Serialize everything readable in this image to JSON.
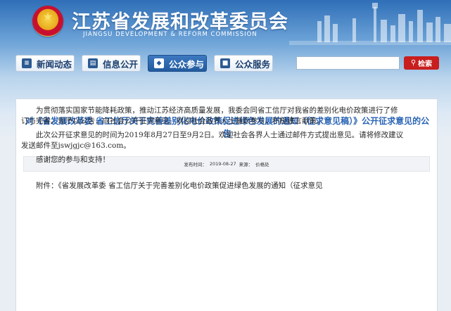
{
  "header": {
    "title": "江苏省发展和改革委员会",
    "subtitle": "JIANGSU DEVELOPMENT & REFORM COMMISSION"
  },
  "nav": {
    "items": [
      {
        "label": "新闻动态",
        "icon": "news-icon"
      },
      {
        "label": "信息公开",
        "icon": "document-icon"
      },
      {
        "label": "公众参与",
        "icon": "chat-icon",
        "active": true
      },
      {
        "label": "公众服务",
        "icon": "folder-icon"
      }
    ]
  },
  "search": {
    "value": "",
    "button_label": "检索",
    "icon": "search-icon"
  },
  "article": {
    "title": "对《省发展改革委 省工信厅关于完善差别化电价政策促进绿色发展的通知（征求意见稿）》公开征求意见的公告",
    "meta": {
      "publish_label": "发布时间：",
      "publish_date": "2019-08-27",
      "source_label": "来源：",
      "source": "价格处"
    },
    "paragraphs": [
      "为贯彻落实国家节能降耗政策，推动江苏经济高质量发展，我委会同省工信厅对我省的差别化电价政策进行了修订与完善。现予以公告，向社会公开征求意见。欢迎社会各界人士踊跃参与，积极建言献策。",
      "此次公开征求意见的时间为2019年8月27日至9月2日。欢迎社会各界人士通过邮件方式提出意见。请将修改建议发送邮件至jswjgjc@163.com。",
      "感谢您的参与和支持！"
    ],
    "attachment": "附件：《省发展改革委 省工信厅关于完善差别化电价政策促进绿色发展的通知（征求意见"
  },
  "colors": {
    "title_blue": "#2a64b5",
    "nav_active": "#225a9e",
    "search_button": "#c81e1e"
  }
}
